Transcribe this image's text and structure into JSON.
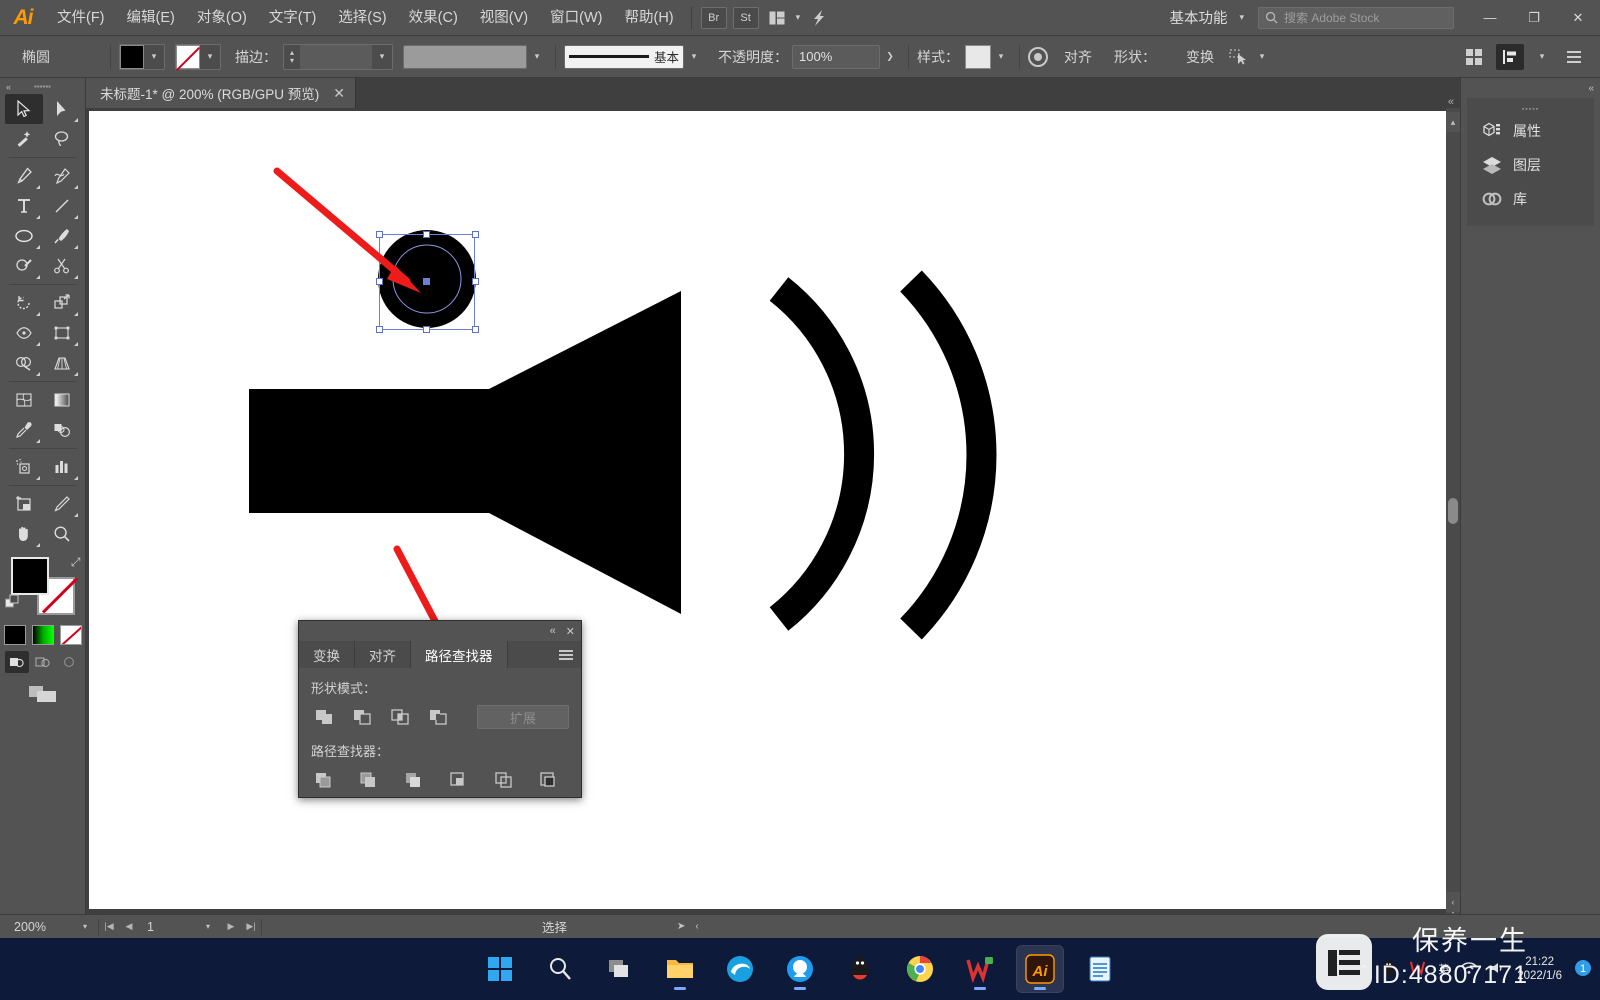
{
  "app": {
    "logo": "Ai",
    "menus": [
      "文件(F)",
      "编辑(E)",
      "对象(O)",
      "文字(T)",
      "选择(S)",
      "效果(C)",
      "视图(V)",
      "窗口(W)",
      "帮助(H)"
    ],
    "quick_buttons": [
      "Br",
      "St"
    ],
    "workspace": "基本功能",
    "search_placeholder": "搜索 Adobe Stock",
    "window_buttons": {
      "minimize": "—",
      "restore": "❐",
      "close": "✕"
    }
  },
  "control_bar": {
    "object_type": "椭圆",
    "fill_label": "fill-swatch",
    "stroke_label": "描边：",
    "stroke_weight": "",
    "profile_text": "基本",
    "opacity_label": "不透明度：",
    "opacity_value": "100%",
    "style_label": "样式：",
    "align_label": "对齐",
    "shape_label": "形状：",
    "transform_label": "变换",
    "colors": {
      "fill": "#000000",
      "stroke": "none",
      "accent": "#ff9a00"
    }
  },
  "tab": {
    "title": "未标题-1* @ 200% (RGB/GPU 预览)",
    "close": "✕"
  },
  "toolbar": {
    "tools": [
      "selection-tool",
      "direct-selection-tool",
      "magic-wand-tool",
      "lasso-tool",
      "pen-tool",
      "curvature-tool",
      "type-tool",
      "line-segment-tool",
      "ellipse-tool",
      "paintbrush-tool",
      "shaper-tool",
      "scissors-tool",
      "rotate-tool",
      "scale-tool",
      "width-tool",
      "free-transform-tool",
      "shape-builder-tool",
      "perspective-grid-tool",
      "mesh-tool",
      "gradient-tool",
      "eyedropper-tool",
      "blend-tool",
      "symbol-sprayer-tool",
      "column-graph-tool",
      "artboard-tool",
      "slice-tool",
      "hand-tool",
      "zoom-tool"
    ],
    "fill_color": "#000000",
    "stroke_color": "none",
    "mini_swatches": [
      "color-black",
      "gradient-green",
      "none-swatch"
    ]
  },
  "right_panel": {
    "items": [
      {
        "icon": "properties-icon",
        "label": "属性"
      },
      {
        "icon": "layers-icon",
        "label": "图层"
      },
      {
        "icon": "libraries-icon",
        "label": "库"
      }
    ]
  },
  "pathfinder_panel": {
    "tabs": [
      {
        "label": "变换",
        "active": false
      },
      {
        "label": "对齐",
        "active": false
      },
      {
        "label": "路径查找器",
        "active": true
      }
    ],
    "shape_modes_label": "形状模式：",
    "shape_modes": [
      "unite",
      "minus-front",
      "intersect",
      "exclude"
    ],
    "expand_button": "扩展",
    "pathfinders_label": "路径查找器：",
    "pathfinders": [
      "divide",
      "trim",
      "merge",
      "crop",
      "outline",
      "minus-back"
    ],
    "collapse": "«",
    "close": "✕"
  },
  "status_bar": {
    "zoom": "200%",
    "page": "1",
    "status_text": "选择"
  },
  "taskbar": {
    "apps": [
      "windows-start-icon",
      "search-icon",
      "task-view-icon",
      "file-explorer-icon",
      "edge-icon",
      "qq-browser-icon",
      "qq-icon",
      "chrome-icon",
      "wps-icon",
      "illustrator-icon",
      "notepad-icon"
    ],
    "tray": {
      "time": "21:22",
      "date": "2022/1/6"
    }
  },
  "watermark": {
    "logo_char": "values",
    "line1": "保养一生",
    "line2": "ID:48807171"
  },
  "canvas": {
    "artwork_name": "speaker-volume-icon",
    "selected_object": "ellipse-selected"
  }
}
